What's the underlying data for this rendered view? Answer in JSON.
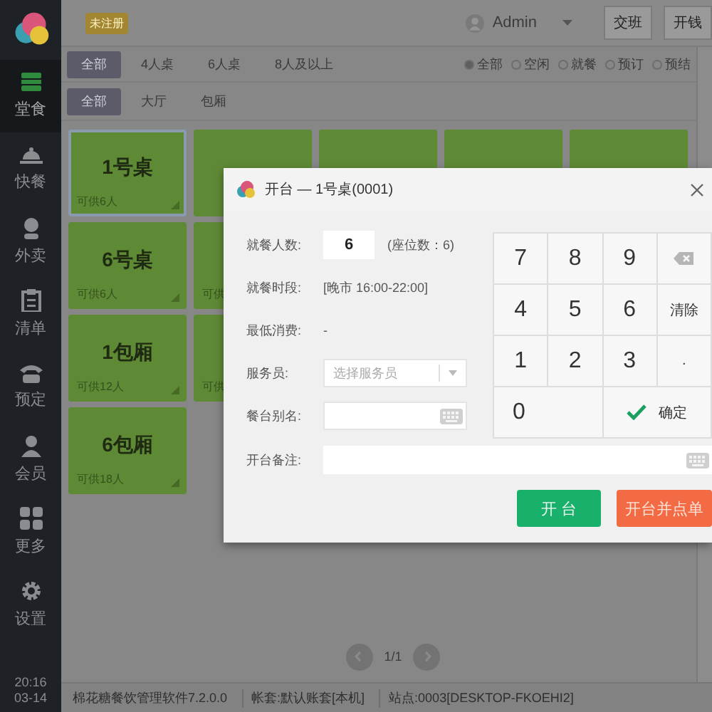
{
  "sidebar": {
    "items": [
      {
        "label": "堂食",
        "selected": true
      },
      {
        "label": "快餐",
        "selected": false
      },
      {
        "label": "外卖",
        "selected": false
      },
      {
        "label": "清单",
        "selected": false
      },
      {
        "label": "预定",
        "selected": false
      },
      {
        "label": "会员",
        "selected": false
      },
      {
        "label": "更多",
        "selected": false
      },
      {
        "label": "设置",
        "selected": false
      }
    ],
    "time": "20:16",
    "date": "03-14"
  },
  "header": {
    "badge": "未注册",
    "user": "Admin",
    "buttons": [
      "交班",
      "开钱"
    ]
  },
  "seat_filters": [
    {
      "label": "全部",
      "selected": true
    },
    {
      "label": "4人桌",
      "selected": false
    },
    {
      "label": "6人桌",
      "selected": false
    },
    {
      "label": "8人及以上",
      "selected": false
    }
  ],
  "status_filters": [
    {
      "label": "全部",
      "selected": true
    },
    {
      "label": "空闲",
      "selected": false
    },
    {
      "label": "就餐",
      "selected": false
    },
    {
      "label": "预订",
      "selected": false
    },
    {
      "label": "预结",
      "selected": false
    }
  ],
  "area_filters": [
    {
      "label": "全部",
      "selected": true
    },
    {
      "label": "大厅",
      "selected": false
    },
    {
      "label": "包厢",
      "selected": false
    }
  ],
  "table_rows": [
    [
      {
        "name": "1号桌",
        "capacity": "可供6人",
        "selected": true
      },
      {
        "selected": false
      },
      {
        "selected": false
      },
      {
        "selected": false
      },
      {
        "selected": false
      }
    ],
    [
      {
        "name": "6号桌",
        "capacity": "可供6人",
        "selected": false
      },
      {
        "capacity": "可供",
        "selected": false
      }
    ],
    [
      {
        "name": "1包厢",
        "capacity": "可供12人",
        "selected": false
      },
      {
        "capacity": "可供",
        "selected": false
      }
    ],
    [
      {
        "name": "6包厢",
        "capacity": "可供18人",
        "selected": false
      }
    ]
  ],
  "pager": {
    "text": "1/1"
  },
  "status_bar": [
    "棉花糖餐饮管理软件7.2.0.0",
    "帐套:默认账套[本机]",
    "站点:0003[DESKTOP-FKOEHI2]"
  ],
  "dialog": {
    "title": "开台 — 1号桌(0001)",
    "fields": [
      {
        "kind": "number",
        "label": "就餐人数:",
        "value": "6",
        "note": "(座位数：6)"
      },
      {
        "kind": "text",
        "label": "就餐时段:",
        "value": "[晚市 16:00-22:00]"
      },
      {
        "kind": "text",
        "label": "最低消费:",
        "value": "-"
      },
      {
        "kind": "select",
        "label": "服务员:",
        "placeholder": "选择服务员"
      },
      {
        "kind": "input",
        "label": "餐台别名:"
      }
    ],
    "remark": {
      "label": "开台备注:"
    },
    "keys": [
      {
        "kind": "digit",
        "label": "7"
      },
      {
        "kind": "digit",
        "label": "8"
      },
      {
        "kind": "digit",
        "label": "9"
      },
      {
        "kind": "backspace"
      },
      {
        "kind": "digit",
        "label": "4"
      },
      {
        "kind": "digit",
        "label": "5"
      },
      {
        "kind": "digit",
        "label": "6"
      },
      {
        "kind": "clear",
        "label": "清除"
      },
      {
        "kind": "digit",
        "label": "1"
      },
      {
        "kind": "digit",
        "label": "2"
      },
      {
        "kind": "digit",
        "label": "3"
      },
      {
        "kind": "clear",
        "label": "."
      },
      {
        "kind": "wide-digit",
        "label": "0"
      },
      {
        "kind": "confirm",
        "label": "确定"
      }
    ],
    "buttons": [
      {
        "kind": "primary",
        "label": "开 台"
      },
      {
        "kind": "secondary",
        "label": "开台并点单"
      }
    ]
  }
}
